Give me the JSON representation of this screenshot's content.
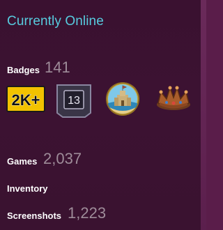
{
  "status": {
    "text": "Currently Online",
    "color": "#57cbde"
  },
  "badges": {
    "label": "Badges",
    "count": "141",
    "items": [
      {
        "icon": "2k-plus-badge-icon",
        "text": "2K+"
      },
      {
        "icon": "level-13-badge-icon",
        "text": "13"
      },
      {
        "icon": "sandcastle-badge-icon"
      },
      {
        "icon": "crown-badge-icon"
      }
    ]
  },
  "games": {
    "label": "Games",
    "count": "2,037"
  },
  "inventory": {
    "label": "Inventory"
  },
  "screenshots": {
    "label": "Screenshots",
    "count": "1,223"
  }
}
